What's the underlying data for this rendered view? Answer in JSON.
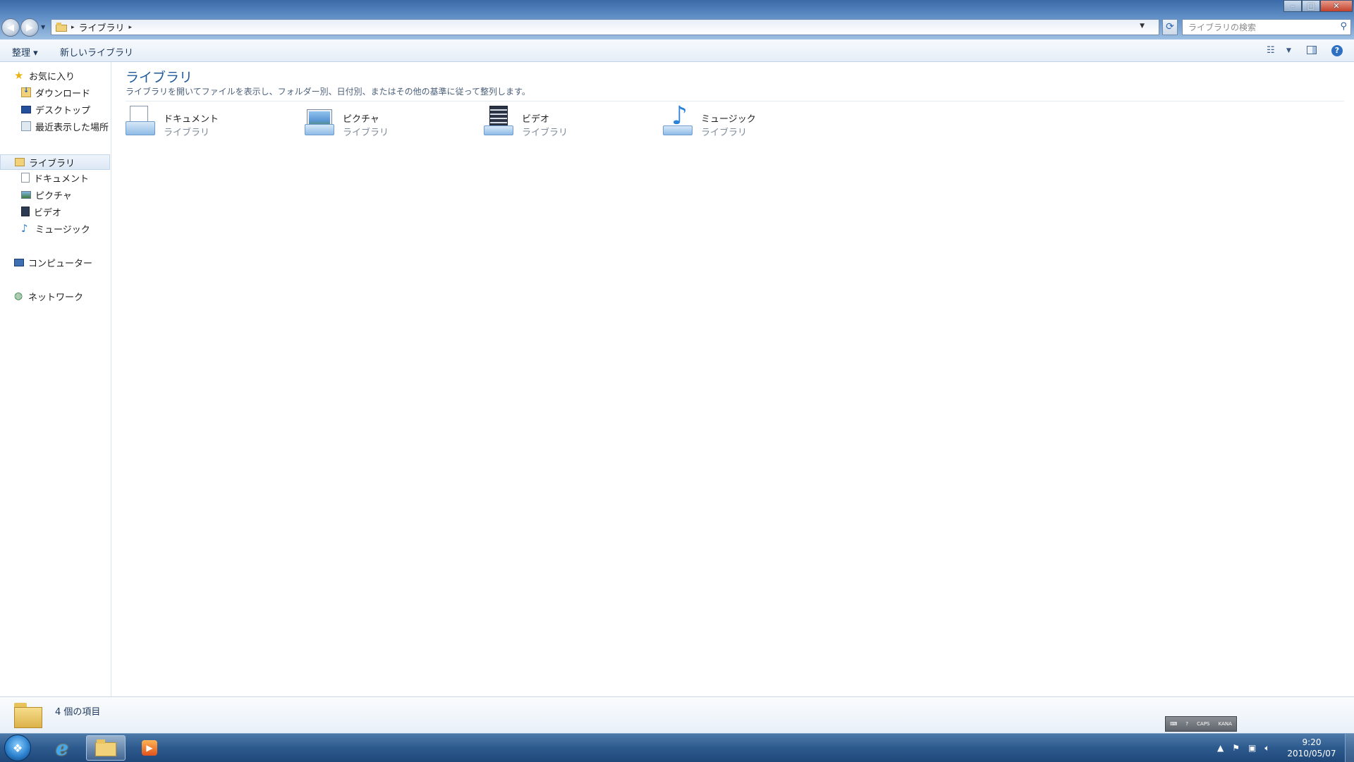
{
  "window": {
    "address": {
      "crumbs": [
        "ライブラリ"
      ]
    },
    "search_placeholder": "ライブラリの検索",
    "controls": {
      "minimize": "–",
      "maximize": "□",
      "close": "✕"
    }
  },
  "toolbar": {
    "organize_label": "整理 ▾",
    "new_library_label": "新しいライブラリ"
  },
  "nav": {
    "favorites": "お気に入り",
    "favorites_items": [
      "ダウンロード",
      "デスクトップ",
      "最近表示した場所"
    ],
    "libraries": "ライブラリ",
    "libraries_items": [
      "ドキュメント",
      "ピクチャ",
      "ビデオ",
      "ミュージック"
    ],
    "computer": "コンピューター",
    "network": "ネットワーク"
  },
  "content": {
    "title": "ライブラリ",
    "description": "ライブラリを開いてファイルを表示し、フォルダー別、日付別、またはその他の基準に従って整列します。",
    "libraries": [
      {
        "name": "ドキュメント",
        "type": "ライブラリ",
        "icon": "documents-library-icon"
      },
      {
        "name": "ピクチャ",
        "type": "ライブラリ",
        "icon": "pictures-library-icon"
      },
      {
        "name": "ビデオ",
        "type": "ライブラリ",
        "icon": "videos-library-icon"
      },
      {
        "name": "ミュージック",
        "type": "ライブラリ",
        "icon": "music-library-icon"
      }
    ]
  },
  "status": {
    "item_count": "4 個の項目"
  },
  "language_bar": {
    "caps": "CAPS",
    "kana": "KANA"
  },
  "taskbar": {
    "clock_time": "9:20",
    "clock_date": "2010/05/07"
  }
}
